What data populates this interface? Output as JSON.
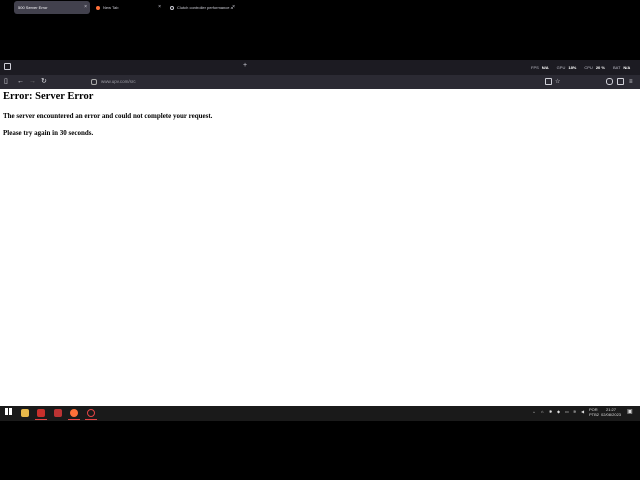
{
  "browser": {
    "tabs": [
      {
        "title": "500 Server Error",
        "active": true
      },
      {
        "title": "New Tab",
        "active": false
      },
      {
        "title": "Clutch controller performance an",
        "active": false
      }
    ],
    "new_tab_label": "+",
    "stats": {
      "fps_label": "FPS",
      "fps_value": "N/A",
      "gpu_label": "GPU",
      "gpu_value": "18%",
      "cpu_label": "CPU",
      "cpu_value": "20 %",
      "bat_label": "BAT",
      "bat_value": "N/A"
    },
    "url": "www.upv.com/src"
  },
  "page": {
    "heading": "Error: Server Error",
    "message": "The server encountered an error and could not complete your request.",
    "retry": "Please try again in 30 seconds."
  },
  "taskbar": {
    "lang_line1": "POR",
    "lang_line2": "PTB2",
    "time": "21:27",
    "date": "02/08/2023"
  },
  "colors": {
    "tab_active": "#42414d",
    "toolbar": "#2b2a33",
    "tabbar": "#1c1b22",
    "accent_red": "#e64545"
  }
}
